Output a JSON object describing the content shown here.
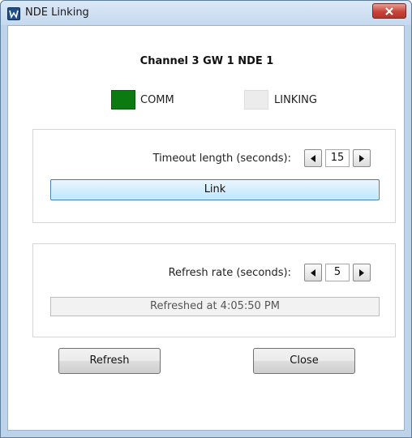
{
  "window": {
    "title": "NDE Linking",
    "app_icon": "app-logo-icon",
    "close_icon": "close-icon"
  },
  "header": {
    "channel_title": "Channel 3  GW 1  NDE 1"
  },
  "indicators": {
    "comm": {
      "label": "COMM",
      "color": "#0b7a11",
      "state": "on"
    },
    "linking": {
      "label": "LINKING",
      "color": "#ececec",
      "state": "off"
    }
  },
  "linking_group": {
    "timeout_label": "Timeout length (seconds):",
    "timeout_value": "15",
    "decrement_icon": "triangle-left-icon",
    "increment_icon": "triangle-right-icon",
    "link_button": "Link"
  },
  "refresh_group": {
    "refresh_rate_label": "Refresh rate (seconds):",
    "refresh_rate_value": "5",
    "status_text": "Refreshed at 4:05:50 PM"
  },
  "footer": {
    "refresh_button": "Refresh",
    "close_button": "Close"
  }
}
